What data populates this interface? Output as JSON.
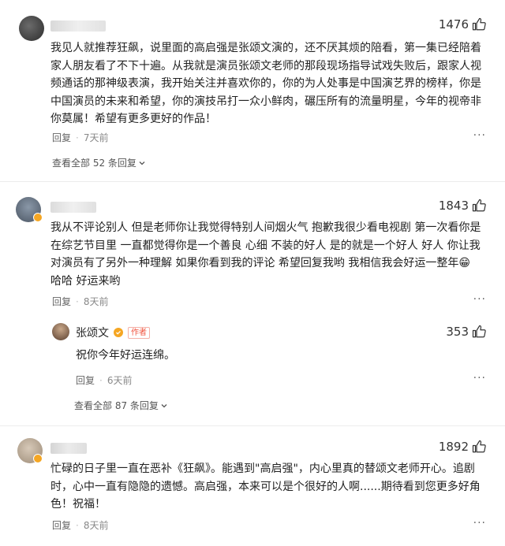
{
  "comments": [
    {
      "likes": "1476",
      "text_lines": [
        "我见人就推荐狂飙，说里面的高启强是张颂文演的，还不厌其烦的陪看，第一集已经陪着",
        "家人朋友看了不下十遍。从我就是演员张颂文老师的那段现场指导试戏失败后，跟家人视",
        "频通话的那神级表演，我开始关注并喜欢你的，你的为人处事是中国演艺界的榜样，你是",
        "中国演员的未来和希望，你的演技吊打一众小鲜肉，碾压所有的流量明星，今年的视帝非",
        "你莫属！希望有更多更好的作品！"
      ],
      "reply_label": "回复",
      "time": "7天前",
      "more": "···",
      "view_all": "查看全部 52 条回复"
    },
    {
      "likes": "1843",
      "text_lines": [
        "我从不评论别人 但是老师你让我觉得特别人间烟火气 抱歉我很少看电视剧 第一次看你是",
        "在综艺节目里 一直都觉得你是一个善良 心细 不装的好人 是的就是一个好人 好人 你让我",
        "对演员有了另外一种理解 如果你看到我的评论 希望回复我哟 我相信我会好运一整年😁",
        "哈哈 好运来哟"
      ],
      "reply_label": "回复",
      "time": "8天前",
      "more": "···",
      "reply": {
        "author": "张颂文",
        "author_tag": "作者",
        "likes": "353",
        "text": "祝你今年好运连绵。",
        "reply_label": "回复",
        "time": "6天前",
        "more": "···"
      },
      "view_all": "查看全部 87 条回复"
    },
    {
      "likes": "1892",
      "text_lines": [
        "忙碌的日子里一直在恶补《狂飙》。能遇到\"高启强\"，内心里真的替颂文老师开心。追剧",
        "时，心中一直有隐隐的遗憾。高启强，本来可以是个很好的人啊......期待看到您更多好角",
        "色！祝福！"
      ],
      "reply_label": "回复",
      "time": "8天前",
      "more": "···"
    }
  ],
  "colors": {
    "text": "#222222",
    "meta": "#888888",
    "author_tag": "#f0523d",
    "verified": "#f5a623",
    "divider": "#ececec"
  },
  "icons": [
    "thumb-up-icon",
    "chevron-down-icon",
    "verified-badge-icon",
    "more-icon"
  ]
}
